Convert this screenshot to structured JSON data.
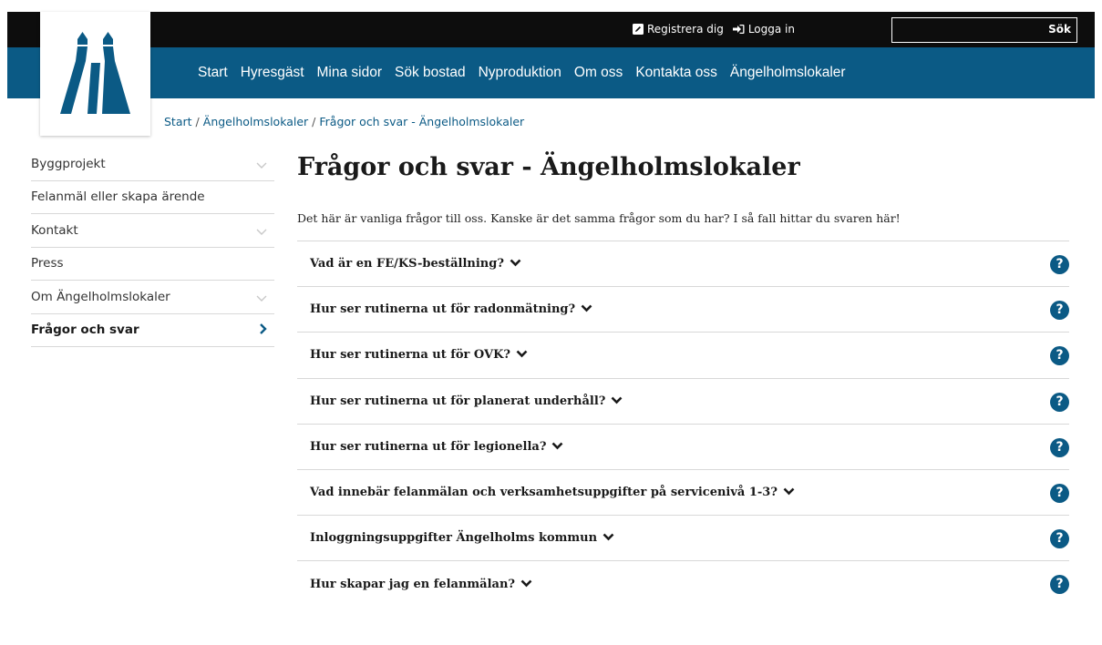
{
  "topbar": {
    "register_label": "Registrera dig",
    "login_label": "Logga in",
    "search_placeholder": "",
    "search_button": "Sök"
  },
  "nav": {
    "items": [
      "Start",
      "Hyresgäst",
      "Mina sidor",
      "Sök bostad",
      "Nyproduktion",
      "Om oss",
      "Kontakta oss",
      "Ängelholmslokaler"
    ]
  },
  "breadcrumb": {
    "items": [
      "Start",
      "Ängelholmslokaler",
      "Frågor och svar - Ängelholmslokaler"
    ]
  },
  "sidebar": {
    "items": [
      {
        "label": "Byggprojekt",
        "has_submenu": true,
        "active": false
      },
      {
        "label": "Felanmäl eller skapa ärende",
        "has_submenu": false,
        "active": false
      },
      {
        "label": "Kontakt",
        "has_submenu": true,
        "active": false
      },
      {
        "label": "Press",
        "has_submenu": false,
        "active": false
      },
      {
        "label": "Om Ängelholmslokaler",
        "has_submenu": true,
        "active": false
      },
      {
        "label": "Frågor och svar",
        "has_submenu": true,
        "active": true
      }
    ]
  },
  "main": {
    "title": "Frågor och svar - Ängelholmslokaler",
    "intro": "Det här är vanliga frågor till oss. Kanske är det samma frågor som du har? I så fall hittar du svaren här!",
    "faq": [
      "Vad är en FE/KS-beställning?",
      "Hur ser rutinerna ut för radonmätning?",
      "Hur ser rutinerna ut för OVK?",
      "Hur ser rutinerna ut för planerat underhåll?",
      "Hur ser rutinerna ut för legionella?",
      "Vad innebär felanmälan och verksamhetsuppgifter på servicenivå 1-3?",
      "Inloggningsuppgifter Ängelholms kommun",
      "Hur skapar jag en felanmälan?"
    ],
    "faq_icon": "question-circle-icon",
    "faq_icon_glyph": "?"
  },
  "colors": {
    "brand_blue": "#0b5a85",
    "topbar_black": "#0d0d0d"
  }
}
